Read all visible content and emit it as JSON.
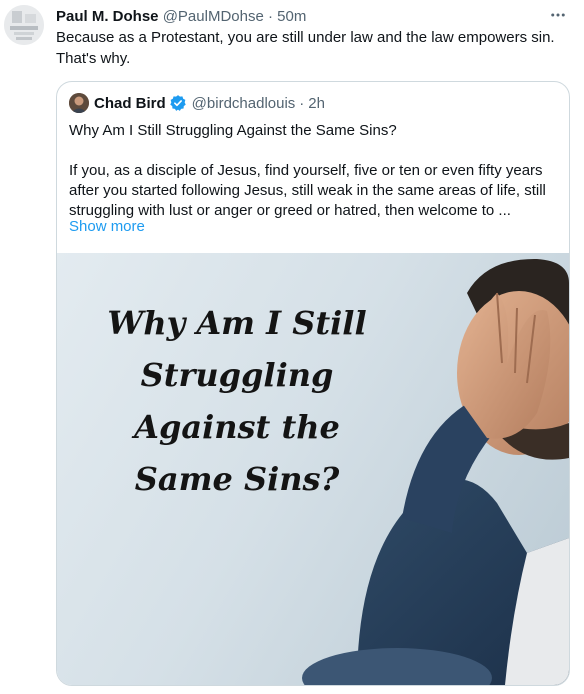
{
  "tweet": {
    "author_name": "Paul M. Dohse",
    "author_handle": "@PaulMDohse",
    "separator": "·",
    "time": "50m",
    "text": "Because as a Protestant, you are still under law and the law empowers sin. That's why."
  },
  "quote": {
    "author_name": "Chad Bird",
    "author_handle": "@birdchadlouis",
    "separator": "·",
    "time": "2h",
    "title": "Why Am I Still Struggling Against the Same Sins?",
    "body": "If you, as a disciple of Jesus, find yourself, five or ten or even fifty years after you started following Jesus, still weak in the same areas of life, still struggling with lust or anger or greed or hatred, then welcome to ...",
    "show_more": "Show more",
    "image_title_lines": [
      "Why Am I Still",
      "Struggling",
      "Against the",
      "Same Sins?"
    ]
  },
  "icons": {
    "more": "more-horizontal-icon",
    "verified": "verified-badge-icon"
  },
  "colors": {
    "text_primary": "#0f1419",
    "text_secondary": "#536471",
    "link": "#1d9bf0",
    "verified": "#1d9bf0",
    "border": "#cfd9de"
  }
}
